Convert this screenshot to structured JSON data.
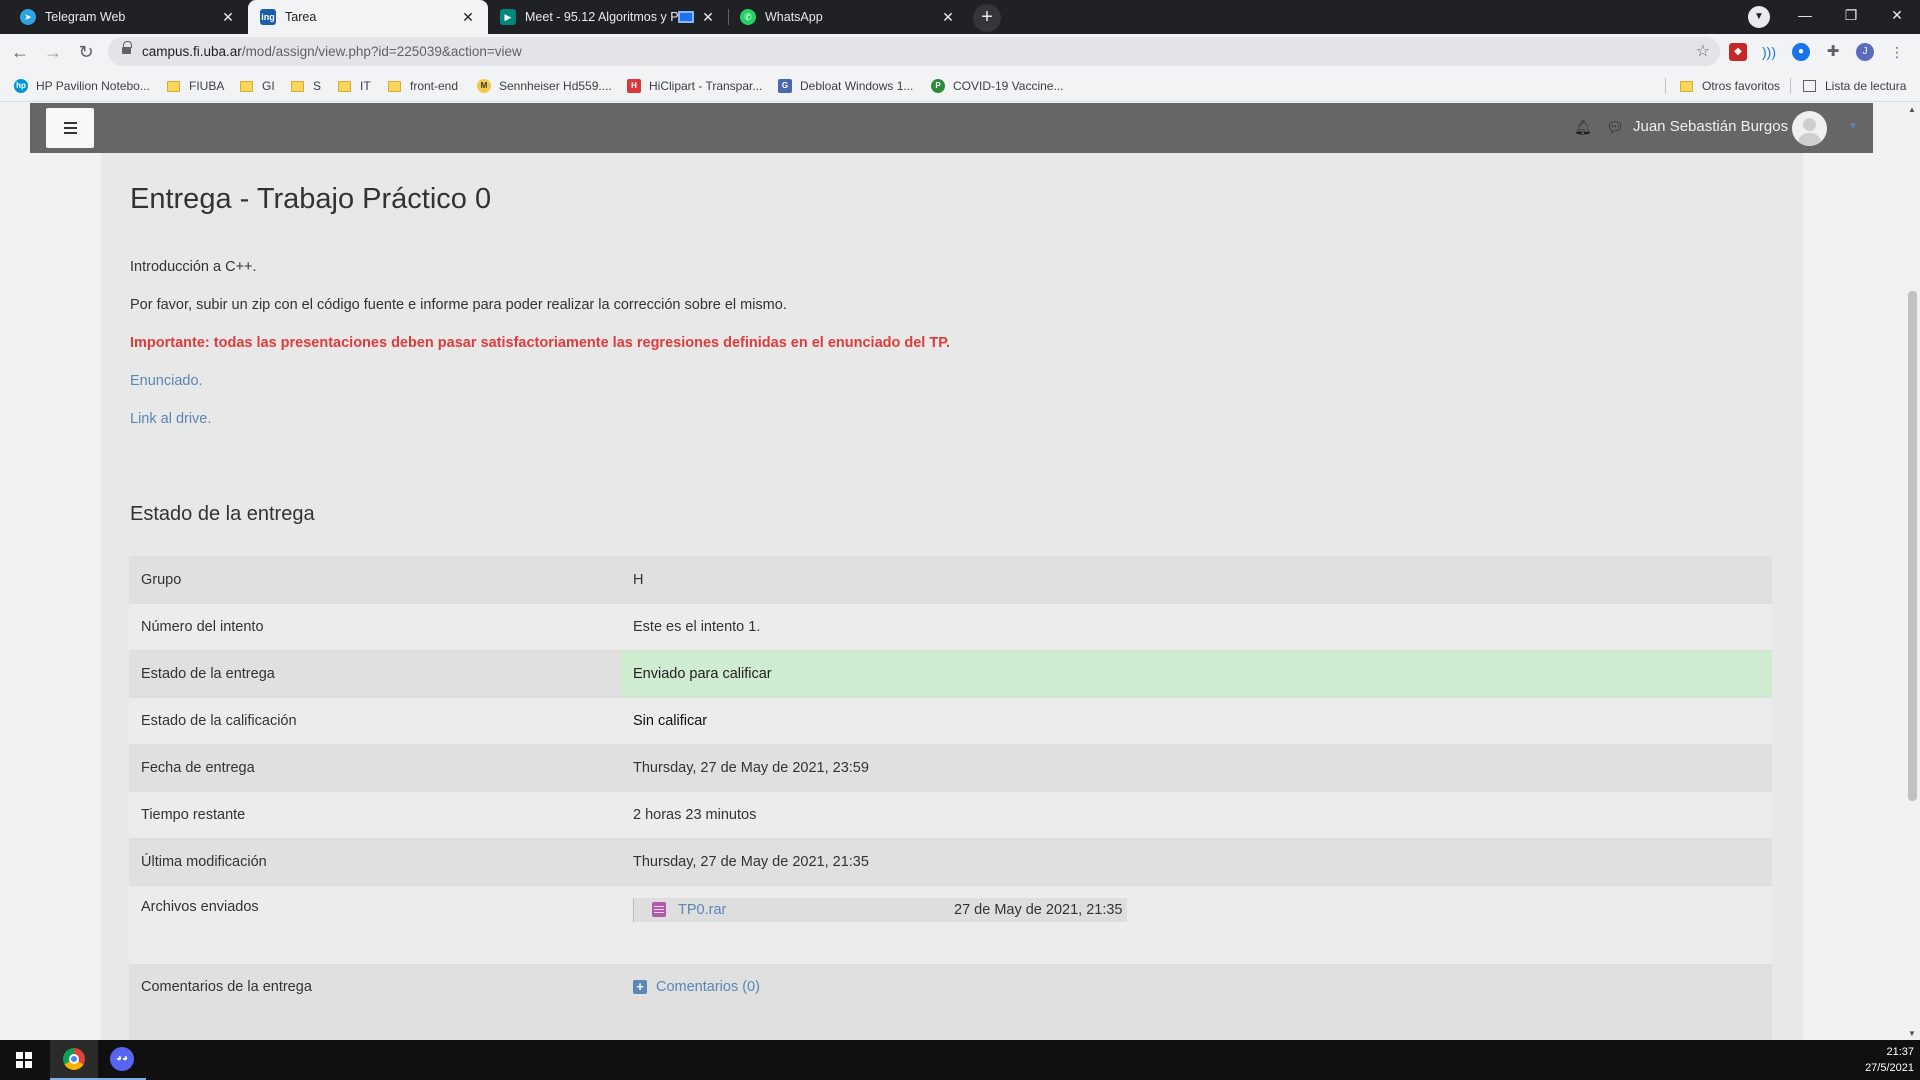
{
  "browser": {
    "tabs": [
      {
        "title": "Telegram Web",
        "icon": "telegram-icon",
        "color": "#2ca5e0",
        "active": false
      },
      {
        "title": "Tarea",
        "icon": "fiuba-icon",
        "color": "#1c5ea8",
        "active": true
      },
      {
        "title": "Meet - 95.12 Algoritmos y P...",
        "icon": "meet-icon",
        "color": "#00897b",
        "active": false
      },
      {
        "title": "WhatsApp",
        "icon": "whatsapp-icon",
        "color": "#25d366",
        "active": false
      }
    ],
    "url_host": "campus.fi.uba.ar",
    "url_path": "/mod/assign/view.php?id=225039&action=view",
    "profile_initial": "J",
    "bookmarks": [
      {
        "label": "HP Pavilion Notebo...",
        "type": "site",
        "color": "#0096d6",
        "glyph": "hp"
      },
      {
        "label": "FIUBA",
        "type": "folder"
      },
      {
        "label": "GI",
        "type": "folder"
      },
      {
        "label": "S",
        "type": "folder"
      },
      {
        "label": "IT",
        "type": "folder"
      },
      {
        "label": "front-end",
        "type": "folder"
      },
      {
        "label": "Sennheiser Hd559....",
        "type": "site",
        "color": "#f2c94c",
        "glyph": "M"
      },
      {
        "label": "HiClipart - Transpar...",
        "type": "site",
        "color": "#d93838",
        "glyph": "H"
      },
      {
        "label": "Debloat Windows 1...",
        "type": "site",
        "color": "#4a67b0",
        "glyph": "G"
      },
      {
        "label": "COVID-19 Vaccine...",
        "type": "site",
        "color": "#2e8b3a",
        "glyph": "P"
      }
    ],
    "other_bookmarks": "Otros favoritos",
    "reading_list": "Lista de lectura"
  },
  "moodle": {
    "user_name": "Juan Sebastián Burgos",
    "page_title": "Entrega - Trabajo Práctico 0",
    "intro": "Introducción a C++.",
    "instructions": "Por favor, subir un zip con el código fuente e informe para poder realizar la corrección sobre el mismo.",
    "important": "Importante: todas las presentaciones deben pasar satisfactoriamente las regresiones definidas en el enunciado del TP.",
    "link_statement": "Enunciado.",
    "link_drive": "Link al drive.",
    "status_heading": "Estado de la entrega",
    "status_rows": [
      {
        "label": "Grupo",
        "value": "H"
      },
      {
        "label": "Número del intento",
        "value": "Este es el intento 1."
      },
      {
        "label": "Estado de la entrega",
        "value": "Enviado para calificar"
      },
      {
        "label": "Estado de la calificación",
        "value": "Sin calificar"
      },
      {
        "label": "Fecha de entrega",
        "value": "Thursday, 27 de May de 2021, 23:59"
      },
      {
        "label": "Tiempo restante",
        "value": "2 horas 23 minutos"
      },
      {
        "label": "Última modificación",
        "value": "Thursday, 27 de May de 2021, 21:35"
      },
      {
        "label": "Archivos enviados",
        "file_name": "TP0.rar",
        "file_date": "27 de May de 2021, 21:35"
      },
      {
        "label": "Comentarios de la entrega",
        "comments_link": "Comentarios (0)"
      }
    ],
    "colors": {
      "accent_link": "#5b86b5",
      "warning": "#e03b3b",
      "success_cell": "#d0ecd0"
    }
  },
  "taskbar": {
    "time": "21:37",
    "date": "27/5/2021"
  }
}
